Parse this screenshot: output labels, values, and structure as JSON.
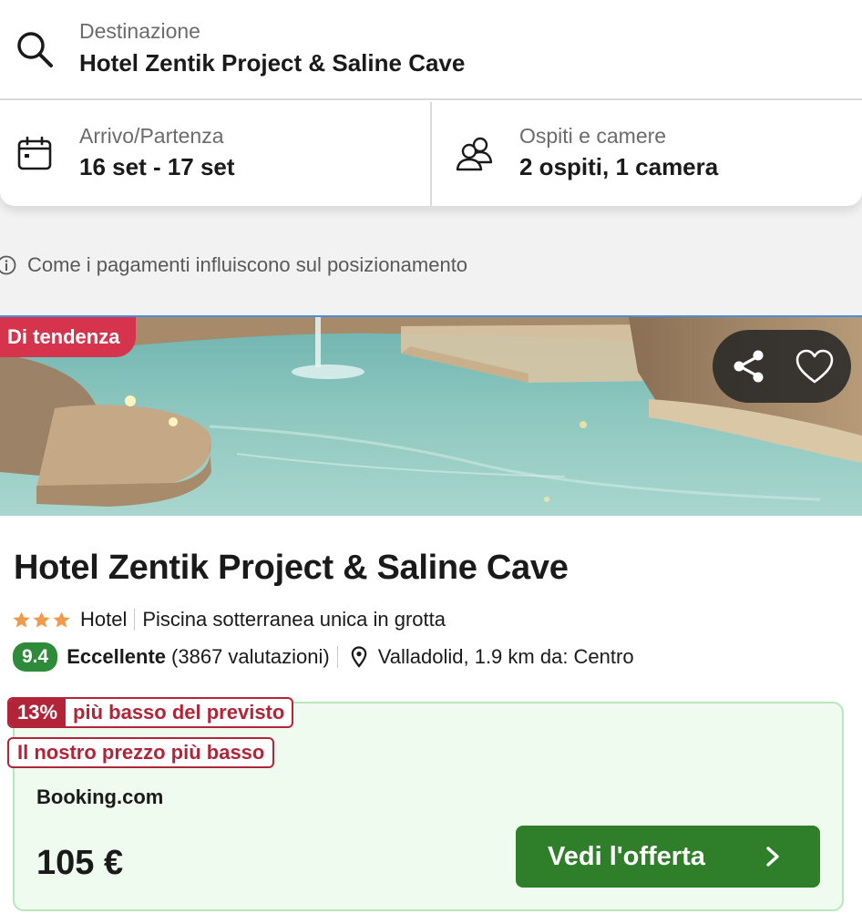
{
  "search": {
    "destination_label": "Destinazione",
    "destination_value": "Hotel Zentik Project & Saline Cave",
    "dates_label": "Arrivo/Partenza",
    "dates_value": "16 set - 17 set",
    "guests_label": "Ospiti e camere",
    "guests_value": "2 ospiti, 1 camera",
    "icons": [
      "search-icon",
      "calendar-icon",
      "users-icon"
    ]
  },
  "info_notice": {
    "text": "Come i pagamenti influiscono sul posizionamento",
    "icon": "info-icon"
  },
  "listing": {
    "badge": "Di tendenza",
    "name": "Hotel Zentik Project & Saline Cave",
    "stars": 3,
    "type": "Hotel",
    "highlight": "Piscina sotterranea unica in grotta",
    "score": "9.4",
    "score_word": "Eccellente",
    "reviews": "(3867 valutazioni)",
    "location": "Valladolid, 1.9 km da: Centro",
    "colors": {
      "score_bg": "#2e8b3a",
      "badge_bg": "#d6344c",
      "star": "#f2994a"
    }
  },
  "deal": {
    "discount_pct": "13%",
    "discount_text": "più basso del previsto",
    "lowest_price_tag": "Il nostro prezzo più basso",
    "provider": "Booking.com",
    "price": "105 €",
    "cta_label": "Vedi l'offerta",
    "colors": {
      "cta_bg": "#2f7f2a",
      "card_bg": "#eefbee",
      "tag": "#b22437"
    }
  }
}
